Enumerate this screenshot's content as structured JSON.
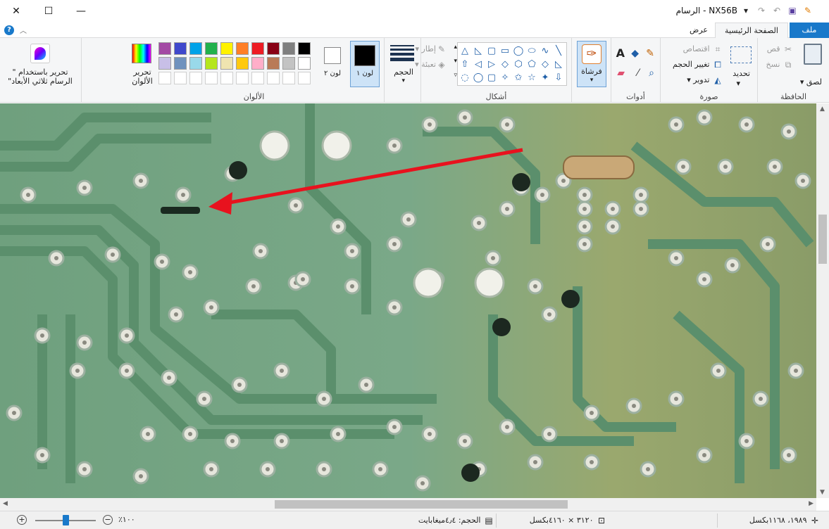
{
  "window": {
    "title": "NX56B - الرسام",
    "minimize_glyph": "—",
    "maximize_glyph": "☐",
    "close_glyph": "✕"
  },
  "tabs": {
    "file": "ملف",
    "home": "الصفحة الرئيسية",
    "view": "عرض"
  },
  "ribbon": {
    "clipboard": {
      "label": "الحافظة",
      "paste": "لصق",
      "cut": "قص",
      "copy": "نسخ"
    },
    "image": {
      "label": "صورة",
      "select": "تحديد",
      "crop": "اقتصاص",
      "resize": "تغيير الحجم",
      "rotate": "تدوير"
    },
    "tools": {
      "label": "أدوات",
      "text_glyph": "A"
    },
    "brushes": {
      "label": "فرشاة"
    },
    "shapes": {
      "label": "أشكال",
      "outline": "إطار",
      "fill": "تعبئة"
    },
    "size": {
      "label": "الحجم"
    },
    "colors": {
      "label": "الألوان",
      "color1": "لون ١",
      "color2": "لون ٢",
      "edit_colors": "تحرير الألوان",
      "paint3d": "تحرير باستخدام \" الرسام ثلاثي الأبعاد\"",
      "color1_value": "#000000",
      "color2_value": "#ffffff",
      "palette_row1": [
        "#000000",
        "#7f7f7f",
        "#880015",
        "#ed1c24",
        "#ff7f27",
        "#fff200",
        "#22b14c",
        "#00a2e8",
        "#3f48cc",
        "#a349a4"
      ],
      "palette_row2": [
        "#ffffff",
        "#c3c3c3",
        "#b97a57",
        "#ffaec9",
        "#ffc90e",
        "#efe4b0",
        "#b5e61d",
        "#99d9ea",
        "#7092be",
        "#c8bfe7"
      ]
    }
  },
  "status": {
    "cursor_pos": "١٩٨٩، ١١٦٨بكسل",
    "image_dims": "٣١٢٠ × ٤١٦٠بكسل",
    "file_size": "الحجم: ٤٫٤ميغابايت",
    "zoom": "١٠٠٪",
    "zoom_level": 0.5
  },
  "canvas": {
    "annotation_color": "#e8121e"
  }
}
